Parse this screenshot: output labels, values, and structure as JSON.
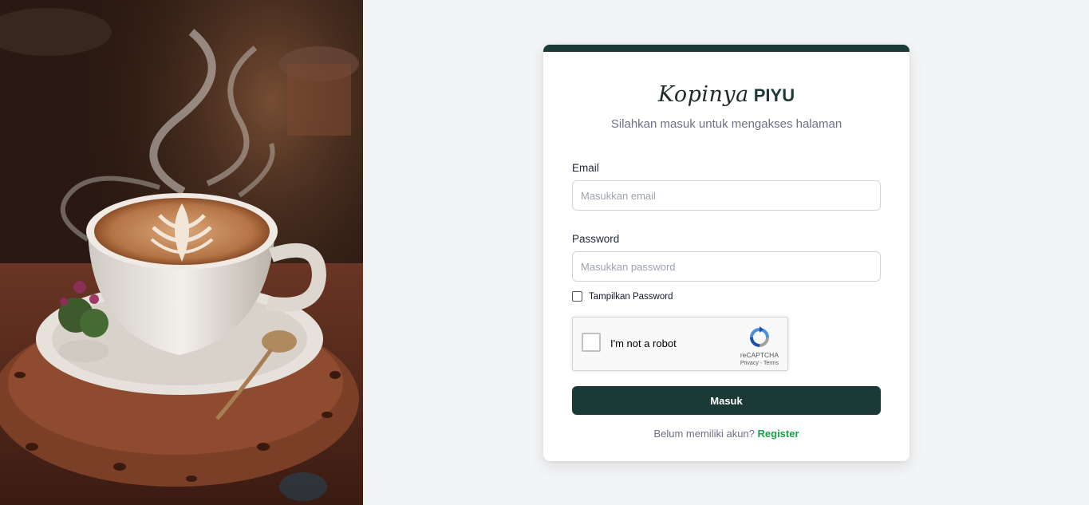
{
  "hero": {
    "image_name": "coffee-latte-photo"
  },
  "brand": {
    "script_text": "Kopinya",
    "bold_text": "PIYU"
  },
  "subtitle": "Silahkan masuk untuk mengakses halaman",
  "form": {
    "email_label": "Email",
    "email_placeholder": "Masukkan email",
    "email_value": "",
    "password_label": "Password",
    "password_placeholder": "Masukkan password",
    "password_value": "",
    "show_password_label": "Tampilkan Password",
    "show_password_checked": false,
    "submit_label": "Masuk"
  },
  "recaptcha": {
    "label": "I'm not a robot",
    "brand": "reCAPTCHA",
    "privacy": "Privacy",
    "separator": " - ",
    "terms": "Terms"
  },
  "footer": {
    "prompt": "Belum memiliki akun?",
    "register_label": "Register"
  },
  "colors": {
    "accent_dark": "#1c3a35",
    "link_green": "#16a34a",
    "page_bg": "#f3f4f6"
  }
}
